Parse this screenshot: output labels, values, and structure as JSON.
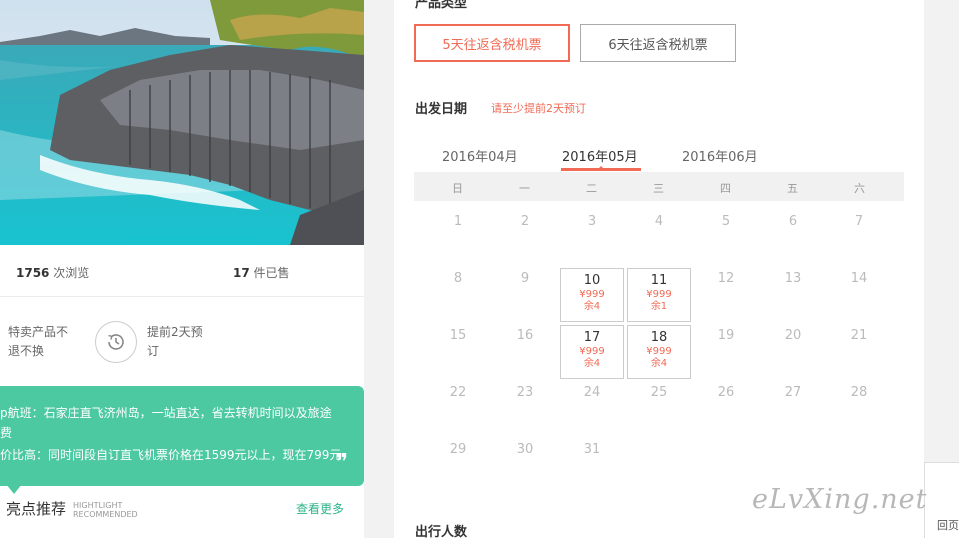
{
  "stats": {
    "views_count": "1756",
    "views_label": "次浏览",
    "sold_count": "17",
    "sold_label": "件已售"
  },
  "features": {
    "item1_line1": "特卖产品不",
    "item1_line2": "退不换",
    "item2_line1": "提前2天预",
    "item2_line2": "订"
  },
  "promo": {
    "line1": "p航班：石家庄直飞济州岛，一站直达，省去转机时间以及旅途",
    "line2": "费",
    "line3": "价比高：同时间段自订直飞机票价格在1599元以上，现在799元",
    "quote_mark": "❞"
  },
  "highlight": {
    "title": "亮点推荐",
    "subtitle_en_1": "HIGHTLIGHT",
    "subtitle_en_2": "RECOMMENDED",
    "more": "查看更多"
  },
  "product_type": {
    "title": "产品类型",
    "options": [
      "5天往返含税机票",
      "6天往返含税机票"
    ],
    "selected_index": 0
  },
  "departure": {
    "title": "出发日期",
    "note": "请至少提前2天预订",
    "months": [
      "2016年04月",
      "2016年05月",
      "2016年06月"
    ],
    "active_month_index": 1,
    "weekdays": [
      "日",
      "一",
      "二",
      "三",
      "四",
      "五",
      "六"
    ],
    "days": [
      "1",
      "2",
      "3",
      "4",
      "5",
      "6",
      "7",
      "8",
      "9",
      "12",
      "13",
      "14",
      "15",
      "16",
      "19",
      "20",
      "21",
      "22",
      "23",
      "24",
      "25",
      "26",
      "27",
      "28",
      "29",
      "30",
      "31"
    ],
    "available": [
      {
        "day": "10",
        "price": "¥999",
        "remain": "余4"
      },
      {
        "day": "11",
        "price": "¥999",
        "remain": "余1"
      },
      {
        "day": "17",
        "price": "¥999",
        "remain": "余4"
      },
      {
        "day": "18",
        "price": "¥999",
        "remain": "余4"
      }
    ]
  },
  "travelers": {
    "title": "出行人数"
  },
  "side": {
    "back_label": "回页"
  },
  "watermark": "eLvXing.net",
  "colors": {
    "accent": "#f06a55",
    "promo_green": "#4cc9a1",
    "link_green": "#2db38a"
  }
}
